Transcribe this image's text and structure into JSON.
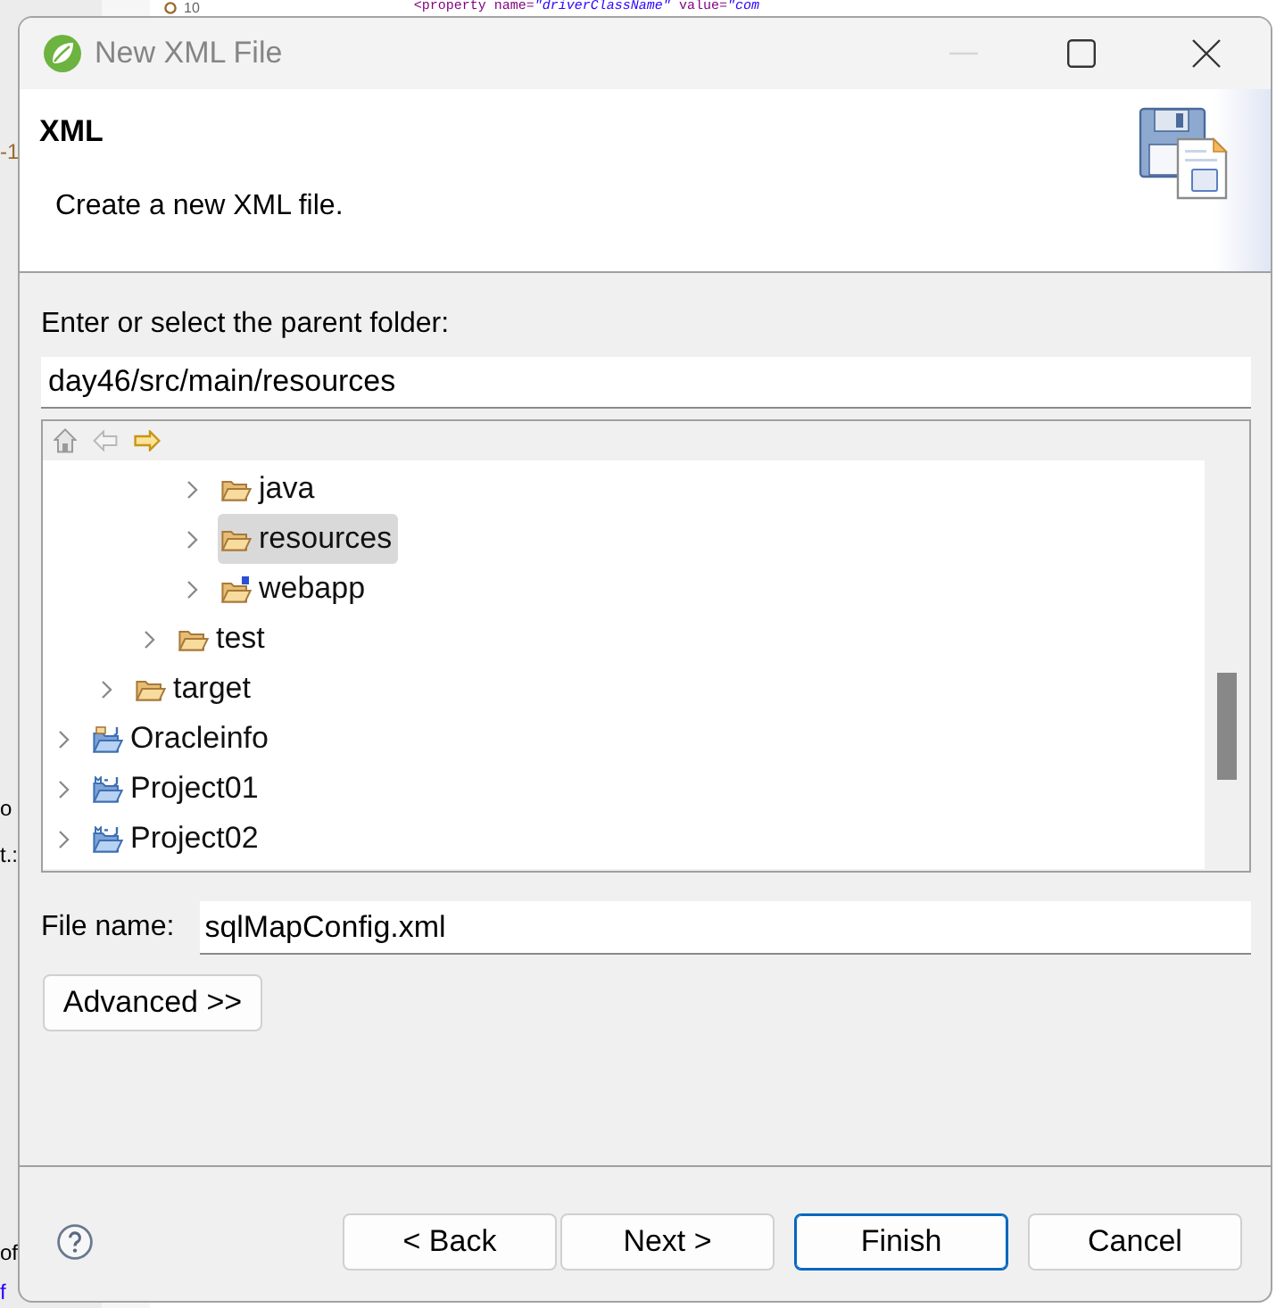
{
  "editor": {
    "line_number": "10",
    "code_line": "<property name=*\"driverClassName\"* value=*\"com*",
    "margin_fragments": [
      {
        "text": "-1",
        "kind": "number"
      },
      {
        "text": "o",
        "kind": "text"
      },
      {
        "text": "t.:",
        "kind": "text"
      },
      {
        "text": "of",
        "kind": "text"
      },
      {
        "text": "f",
        "kind": "link"
      }
    ]
  },
  "window": {
    "title": "New XML File",
    "controls": [
      {
        "kind": "minimize",
        "disabled": true
      },
      {
        "kind": "maximize",
        "disabled": false
      },
      {
        "kind": "close",
        "disabled": false
      }
    ]
  },
  "banner": {
    "title": "XML",
    "description": "Create a new XML file."
  },
  "parent_folder": {
    "label": "Enter or select the parent folder:",
    "value": "day46/src/main/resources"
  },
  "tree_toolbar": [
    {
      "kind": "home",
      "disabled": true
    },
    {
      "kind": "back",
      "disabled": true
    },
    {
      "kind": "forward",
      "disabled": false
    }
  ],
  "tree": [
    {
      "children": [
        {
          "children": [
            {
              "children": [
                {
                  "label": "java",
                  "kind": "folder",
                  "expanded": false,
                  "selected": false
                },
                {
                  "label": "resources",
                  "kind": "folder",
                  "expanded": false,
                  "selected": true
                },
                {
                  "label": "webapp",
                  "kind": "badged-folder",
                  "expanded": false,
                  "selected": false
                }
              ]
            },
            {
              "label": "test",
              "kind": "folder",
              "expanded": false,
              "selected": false
            }
          ]
        },
        {
          "label": "target",
          "kind": "folder",
          "expanded": false,
          "selected": false
        }
      ]
    },
    {
      "label": "Oracleinfo",
      "kind": "java-project",
      "expanded": false,
      "selected": false
    },
    {
      "label": "Project01",
      "kind": "maven-project",
      "expanded": false,
      "selected": false
    },
    {
      "label": "Project02",
      "kind": "maven-project",
      "expanded": false,
      "selected": false
    }
  ],
  "file_name": {
    "label": "File name:",
    "value": "sqlMapConfig.xml"
  },
  "advanced_button": {
    "label": "Advanced >>"
  },
  "buttons": [
    {
      "label": "< Back",
      "default": false
    },
    {
      "label": "Next >",
      "default": false
    },
    {
      "label": "Finish",
      "default": true
    },
    {
      "label": "Cancel",
      "default": false
    }
  ]
}
